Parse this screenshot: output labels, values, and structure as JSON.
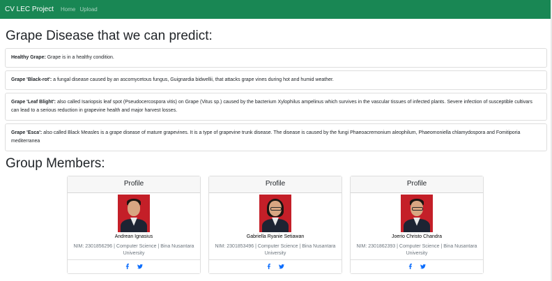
{
  "navbar": {
    "brand": "CV LEC Project",
    "links": [
      "Home",
      "Upload"
    ],
    "bg_color": "#198754"
  },
  "diseases_section": {
    "title": "Grape Disease that we can predict:",
    "items": [
      {
        "name": "Healthy Grape:",
        "description": " Grape is in a healthy condition."
      },
      {
        "name": "Grape 'Black-rot':",
        "description": " a fungal disease caused by an ascomycetous fungus, Guignardia bidwellii, that attacks grape vines during hot and humid weather."
      },
      {
        "name": "Grape 'Leaf Blight':",
        "description": " also called Isariopsis leaf spot (Pseudocercospora vitis) on Grape (Vitus sp.) caused by the bacterium Xylophilus ampelinus which survives in the vascular tissues of infected plants. Severe infection of susceptible cultivars can lead to a serious reduction in grapevine health and major harvest losses."
      },
      {
        "name": "Grape 'Esca':",
        "description": " also called Black Measles is a grape disease of mature grapevines. It is a type of grapevine trunk disease. The disease is caused by the fungi Phaeoacremonium aleophilum, Phaeomoniella chlamydospora and Fomitiporia mediterranea"
      }
    ]
  },
  "members_section": {
    "title": "Group Members:",
    "members": [
      {
        "header": "Profile",
        "name": "Andrean Ignasius",
        "info": "NIM: 2301856296 | Computer Science | Bina Nusantara University",
        "photo_icon": "person-photo"
      },
      {
        "header": "Profile",
        "name": "Gabriella Ryanie Setiawan",
        "info": "NIM: 2301853496 | Computer Science | Bina Nusantara University",
        "photo_icon": "person-photo"
      },
      {
        "header": "Profile",
        "name": "Joerio Christo Chandra",
        "info": "NIM: 2301862393 | Computer Science | Bina Nusantara University",
        "photo_icon": "person-photo"
      }
    ],
    "social_icons": [
      "facebook-icon",
      "twitter-icon"
    ],
    "social_color": "#0d6efd"
  }
}
